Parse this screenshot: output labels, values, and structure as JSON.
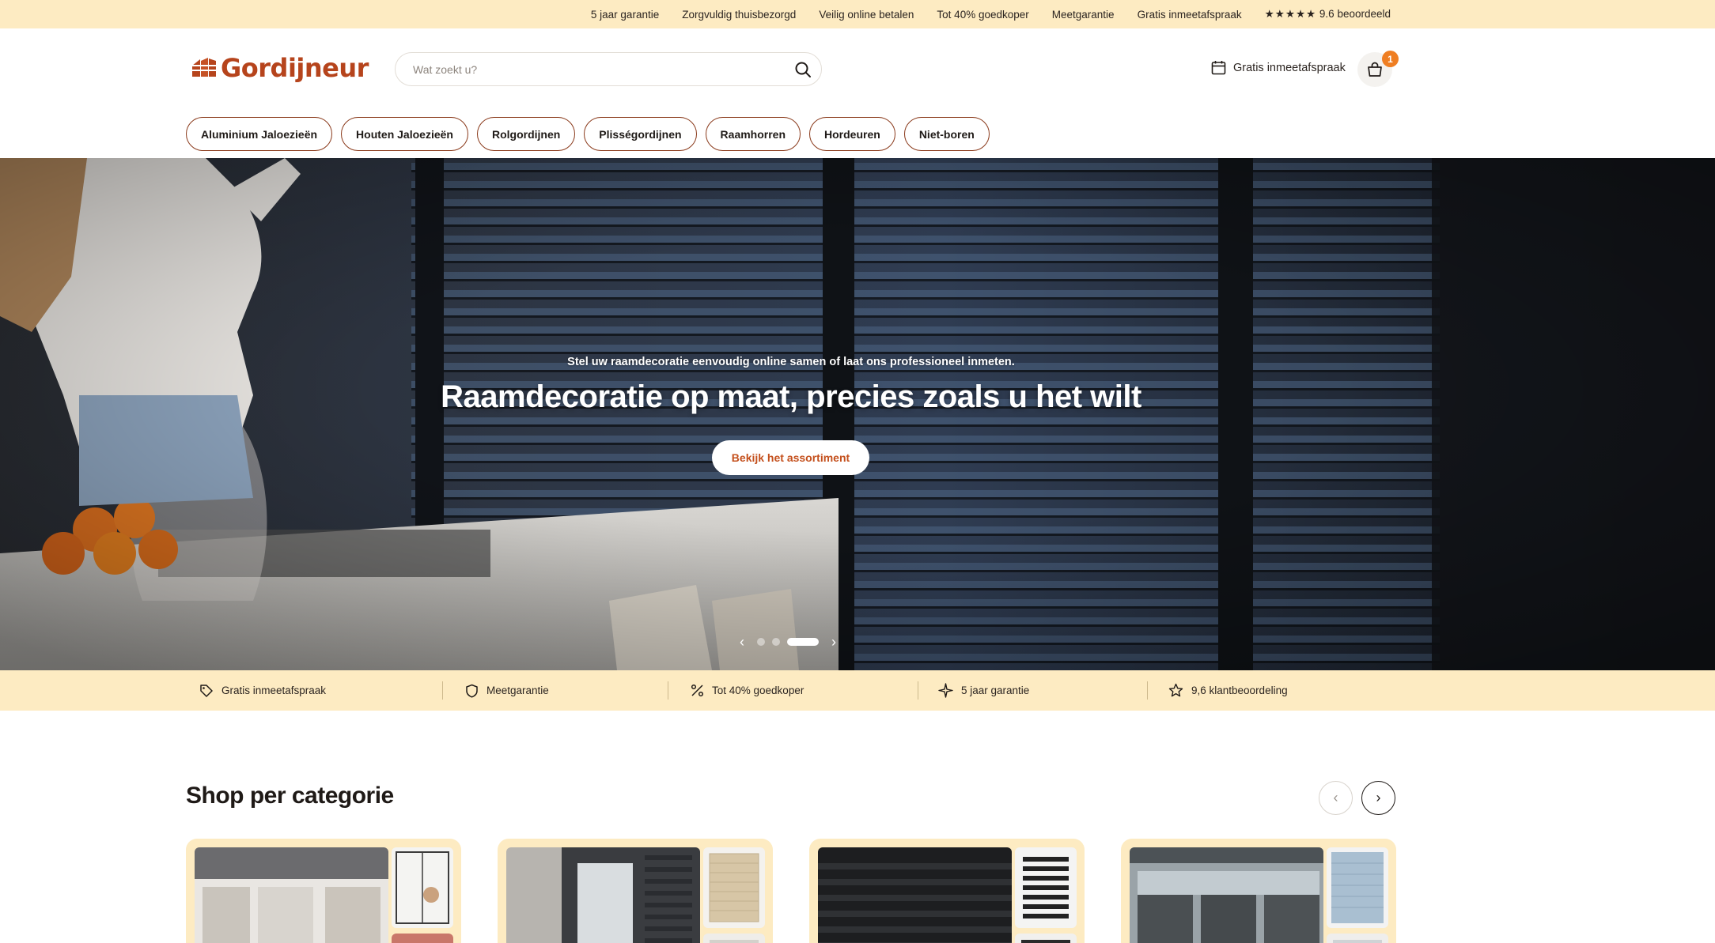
{
  "topbar": {
    "items": [
      "5 jaar garantie",
      "Zorgvuldig thuisbezorgd",
      "Veilig online betalen",
      "Tot 40% goedkoper",
      "Meetgarantie",
      "Gratis inmeetafspraak"
    ],
    "rating_stars": "★★★★★",
    "rating_text": "9.6 beoordeeld"
  },
  "header": {
    "logo_text": "Gordijneur",
    "search_placeholder": "Wat zoekt u?",
    "appointment_label": "Gratis inmeetafspraak",
    "cart_count": "1"
  },
  "colors": {
    "accent": "#ef7e22",
    "brand": "#b6441c",
    "cream": "#fdebc2",
    "pill_border": "#8a3a1b"
  },
  "categories": [
    "Aluminium Jaloezieën",
    "Houten Jaloezieën",
    "Rolgordijnen",
    "Plisségordijnen",
    "Raamhorren",
    "Hordeuren",
    "Niet-boren"
  ],
  "hero": {
    "subtitle": "Stel uw raamdecoratie eenvoudig online samen of laat ons professioneel inmeten.",
    "title": "Raamdecoratie op maat, precies zoals u het wilt",
    "cta_label": "Bekijk het assortiment",
    "slide_count": 3,
    "active_slide": 3
  },
  "usp": {
    "items": [
      {
        "label": "Gratis inmeetafspraak",
        "icon": "tag-icon"
      },
      {
        "label": "Meetgarantie",
        "icon": "shield-icon"
      },
      {
        "label": "Tot 40% goedkoper",
        "icon": "percent-icon"
      },
      {
        "label": "5 jaar garantie",
        "icon": "sparkle-icon"
      },
      {
        "label": "9,6 klantbeoordeling",
        "icon": "star-icon"
      }
    ]
  },
  "shop": {
    "title": "Shop per categorie"
  }
}
